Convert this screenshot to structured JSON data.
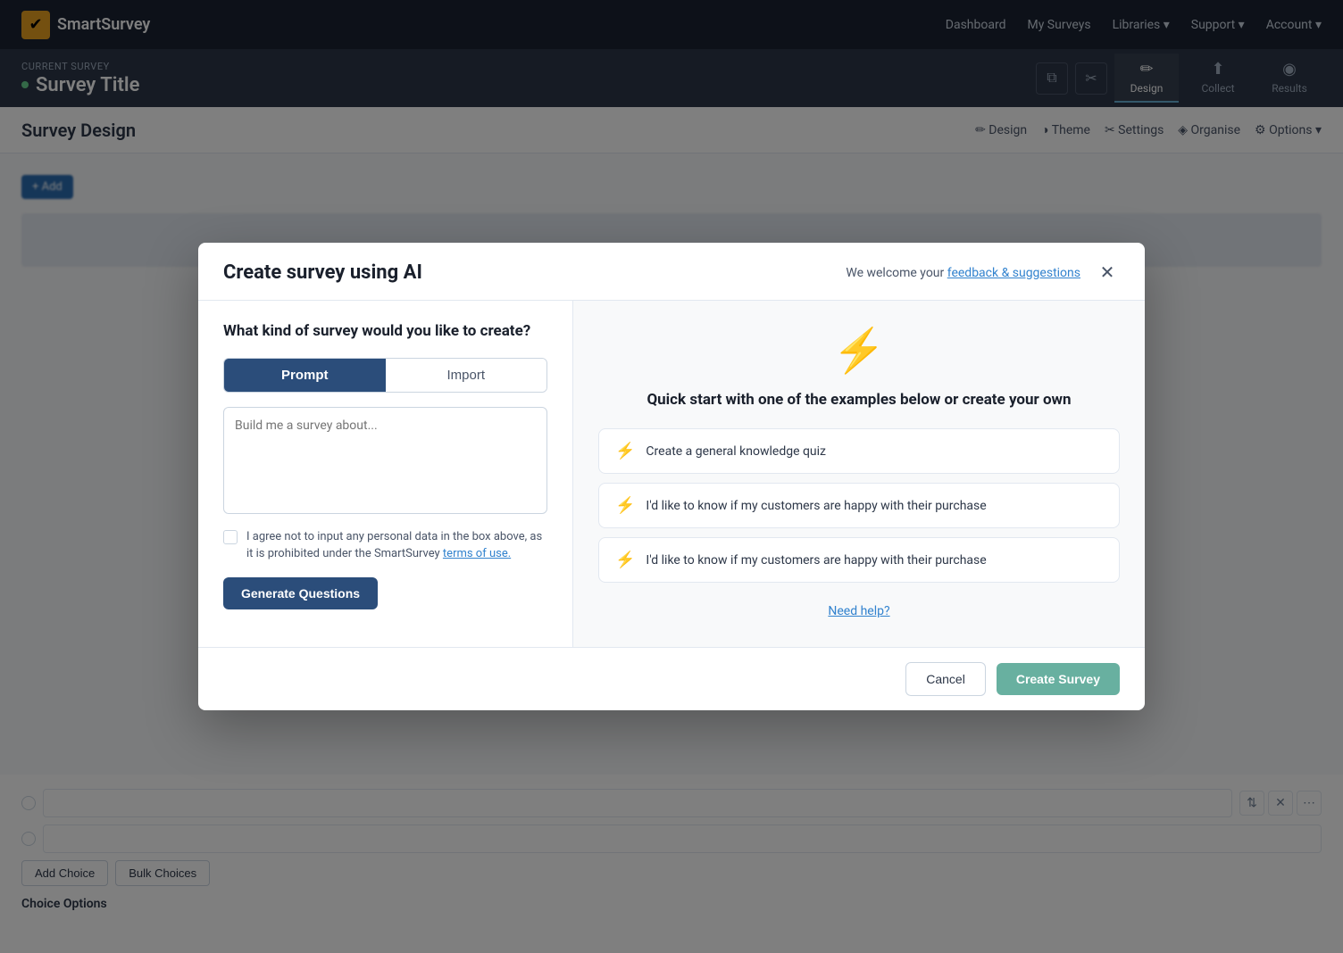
{
  "app": {
    "name": "SmartSurvey"
  },
  "nav": {
    "links": [
      "Dashboard",
      "My Surveys",
      "Libraries",
      "Support",
      "Account"
    ],
    "libraries_label": "Libraries ▾",
    "support_label": "Support ▾",
    "account_label": "Account ▾"
  },
  "subnav": {
    "current_survey_label": "CURRENT SURVEY",
    "survey_title": "Survey Title",
    "tabs": [
      {
        "label": "Design",
        "active": true
      },
      {
        "label": "Collect",
        "active": false
      },
      {
        "label": "Results",
        "active": false
      }
    ]
  },
  "design_header": {
    "title": "Survey Design",
    "tools": [
      "Design",
      "Theme",
      "Settings",
      "Organise",
      "Options"
    ]
  },
  "modal": {
    "title": "Create survey using AI",
    "feedback_prefix": "We welcome your ",
    "feedback_link": "feedback & suggestions",
    "left": {
      "question": "What kind of survey would you like to create?",
      "tab_prompt": "Prompt",
      "tab_import": "Import",
      "textarea_placeholder": "Build me a survey about...",
      "checkbox_label": "I agree not to input any personal data in the box above, as it is prohibited under the SmartSurvey ",
      "terms_link": "terms of use.",
      "generate_btn": "Generate Questions"
    },
    "right": {
      "quickstart_title": "Quick start with one of the examples\nbelow or create your own",
      "examples": [
        {
          "text": "Create a general knowledge quiz"
        },
        {
          "text": "I'd like to know if my customers are happy with their purchase"
        },
        {
          "text": "I'd like to know if my customers are happy with their purchase"
        }
      ],
      "need_help": "Need help?"
    },
    "footer": {
      "cancel": "Cancel",
      "create": "Create Survey"
    }
  },
  "bottom_area": {
    "add_choice": "Add Choice",
    "bulk_choices": "Bulk Choices",
    "choice_options": "Choice Options"
  }
}
